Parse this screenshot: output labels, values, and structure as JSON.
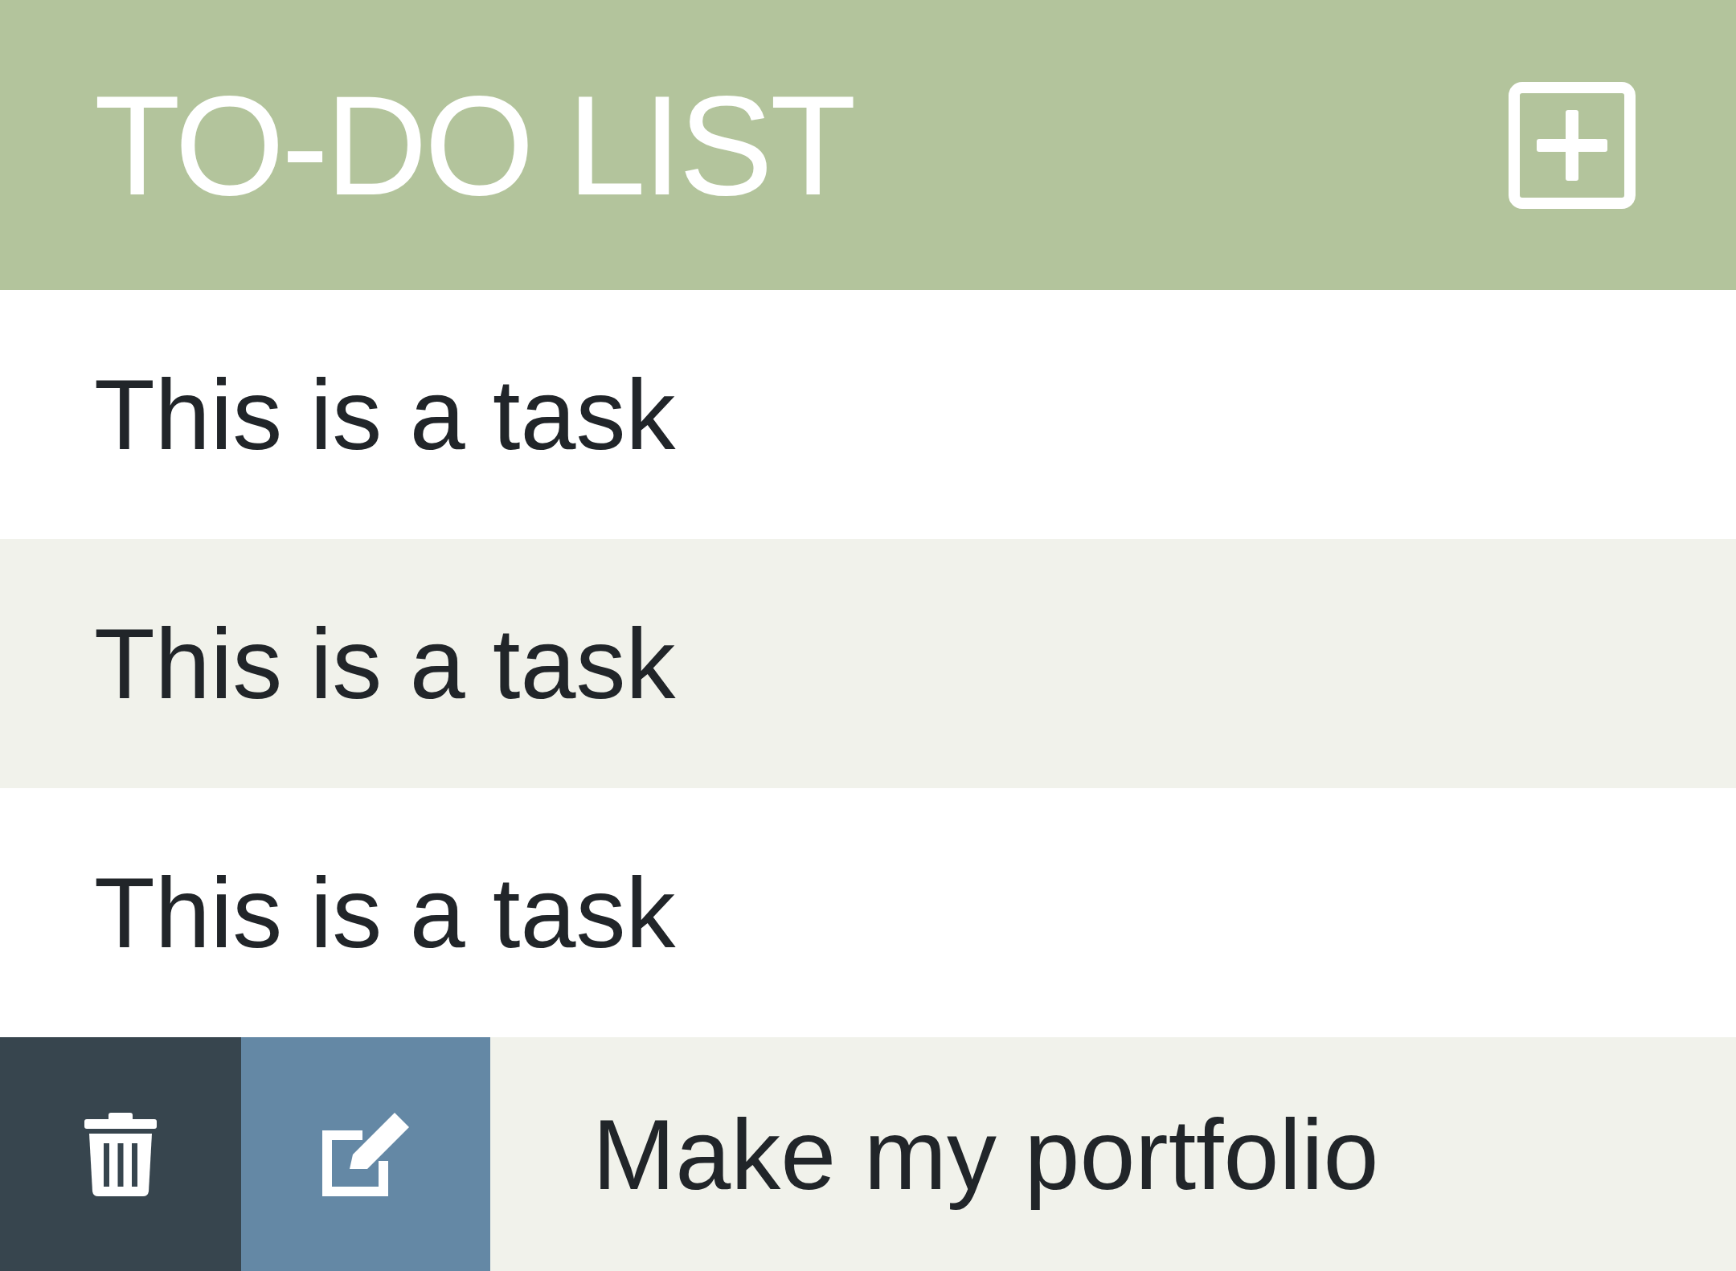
{
  "header": {
    "title": "TO-DO LIST"
  },
  "tasks": [
    {
      "text": "This is a task",
      "actions_shown": false
    },
    {
      "text": "This is a task",
      "actions_shown": false
    },
    {
      "text": "This is a task",
      "actions_shown": false
    },
    {
      "text": "Make my portfolio",
      "actions_shown": true
    }
  ]
}
